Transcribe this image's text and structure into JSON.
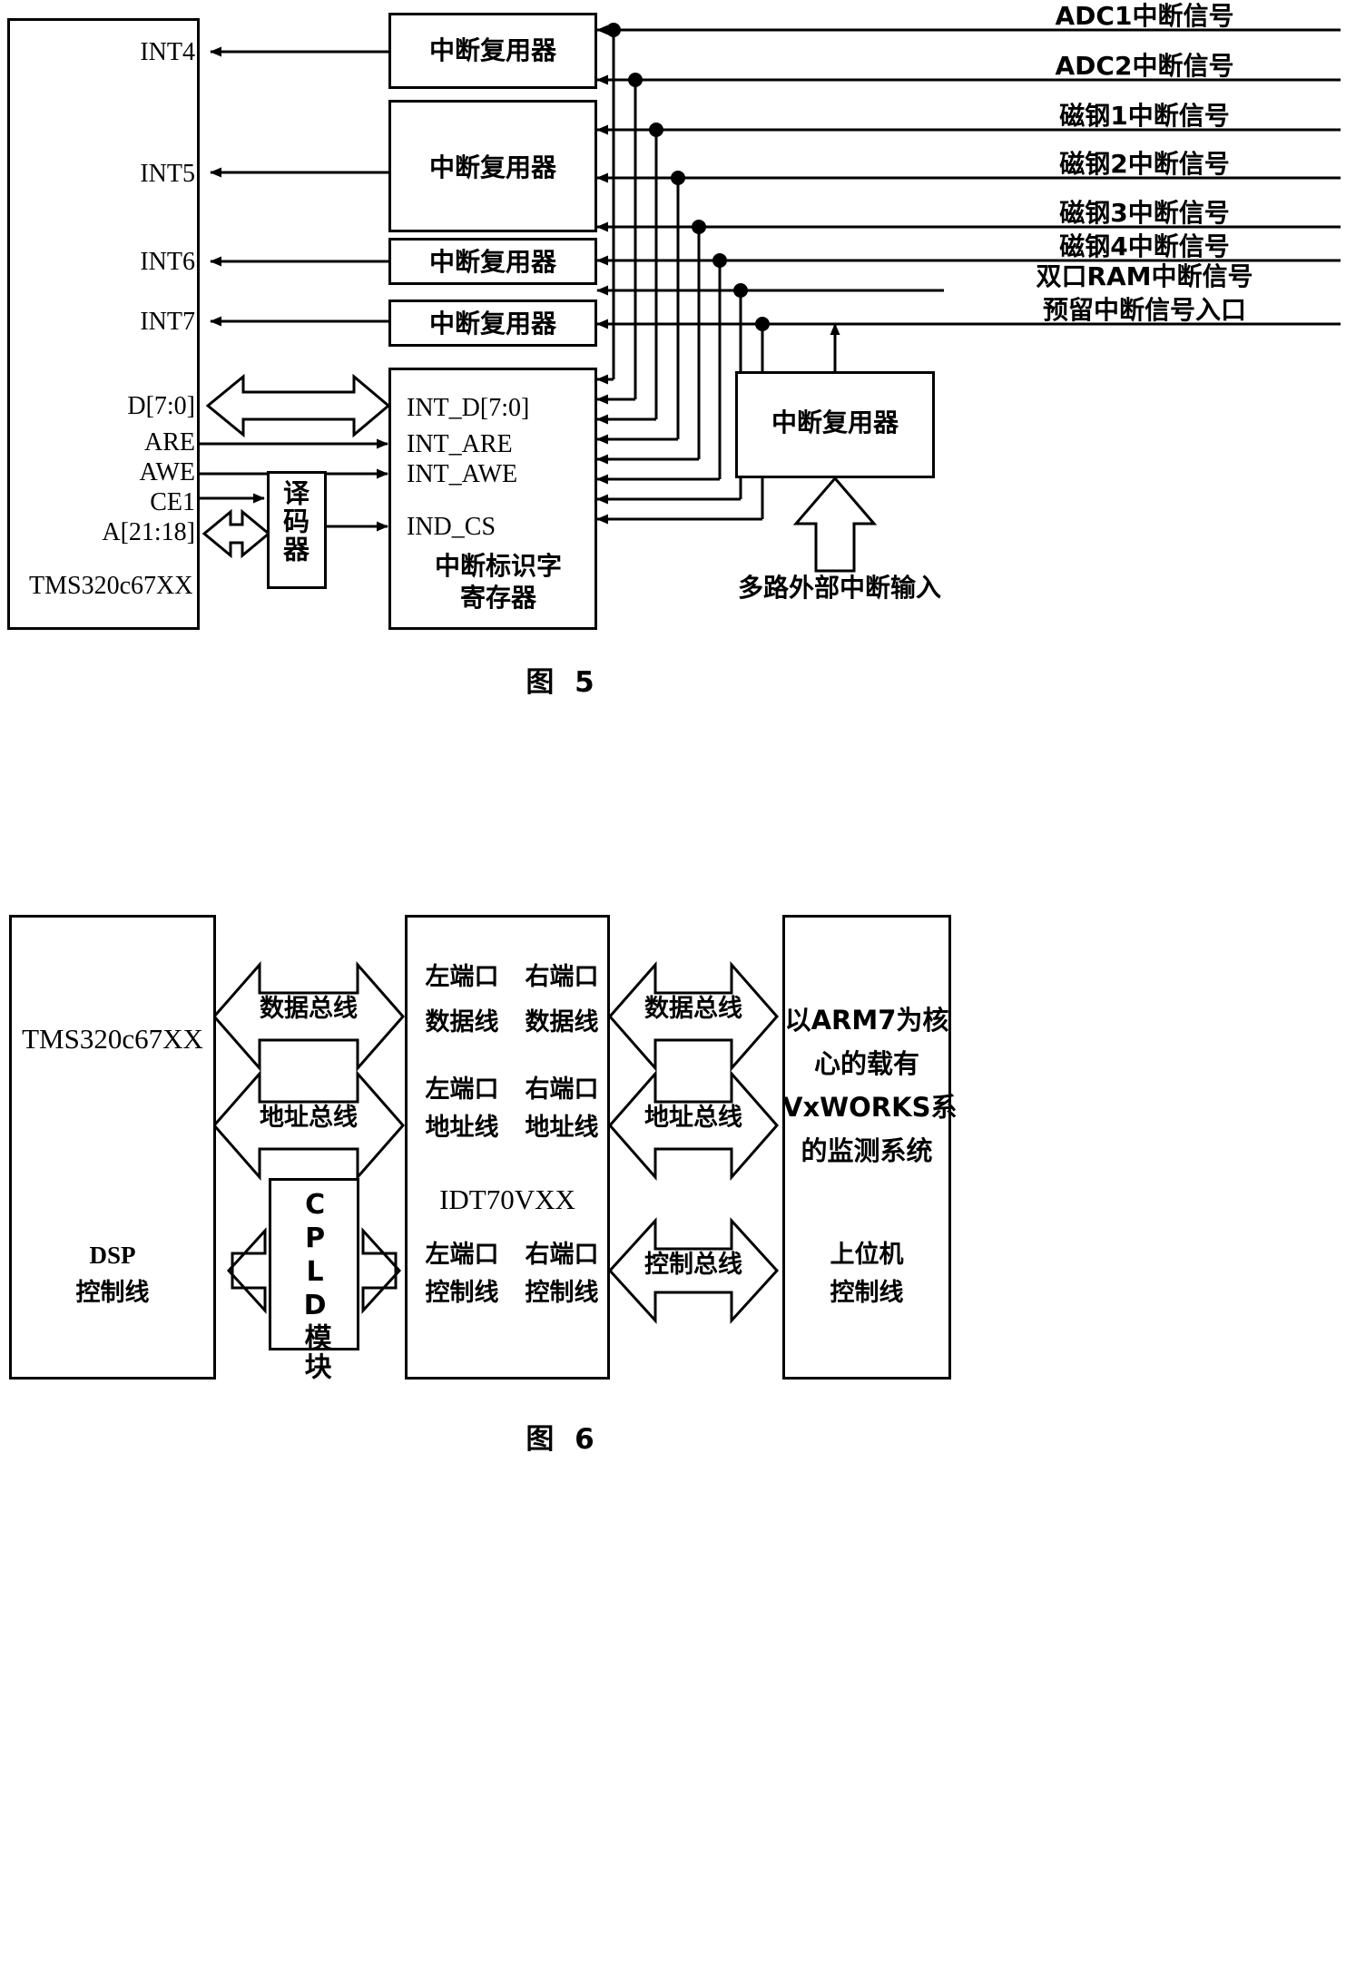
{
  "figure5": {
    "caption": "图 5",
    "dsp_block": {
      "name": "TMS320c67XX",
      "pins": [
        "INT4",
        "INT5",
        "INT6",
        "INT7",
        "D[7:0]",
        "ARE",
        "AWE",
        "CE1",
        "A[21:18]"
      ]
    },
    "decoder_block": {
      "label": "译码器"
    },
    "mux_blocks": [
      {
        "label": "中断复用器"
      },
      {
        "label": "中断复用器"
      },
      {
        "label": "中断复用器"
      },
      {
        "label": "中断复用器"
      }
    ],
    "register_block": {
      "pins": [
        "INT_D[7:0]",
        "INT_ARE",
        "INT_AWE",
        "IND_CS"
      ],
      "title_line1": "中断标识字",
      "title_line2": "寄存器"
    },
    "external_mux": {
      "label": "中断复用器"
    },
    "external_input_label": "多路外部中断输入",
    "signals": [
      "ADC1中断信号",
      "ADC2中断信号",
      "磁钢1中断信号",
      "磁钢2中断信号",
      "磁钢3中断信号",
      "磁钢4中断信号",
      "双口RAM中断信号",
      "预留中断信号入口"
    ]
  },
  "figure6": {
    "caption": "图 6",
    "dsp_block": {
      "name": "TMS320c67XX",
      "ctrl_line1": "DSP",
      "ctrl_line2": "控制线"
    },
    "cpld_block": {
      "label": "CPLD模块"
    },
    "ram_block": {
      "name": "IDT70VXX",
      "rows": [
        {
          "left_l1": "左端口",
          "left_l2": "数据线",
          "right_l1": "右端口",
          "right_l2": "数据线"
        },
        {
          "left_l1": "左端口",
          "left_l2": "地址线",
          "right_l1": "右端口",
          "right_l2": "地址线"
        },
        {
          "left_l1": "左端口",
          "left_l2": "控制线",
          "right_l1": "右端口",
          "right_l2": "控制线"
        }
      ]
    },
    "host_block": {
      "lines": [
        "以ARM7为核",
        "心的载有",
        "VxWORKS系",
        "的监测系统"
      ],
      "ctrl_l1": "上位机",
      "ctrl_l2": "控制线"
    },
    "left_buses": [
      "数据总线",
      "地址总线"
    ],
    "right_buses": [
      "数据总线",
      "地址总线",
      "控制总线"
    ]
  }
}
